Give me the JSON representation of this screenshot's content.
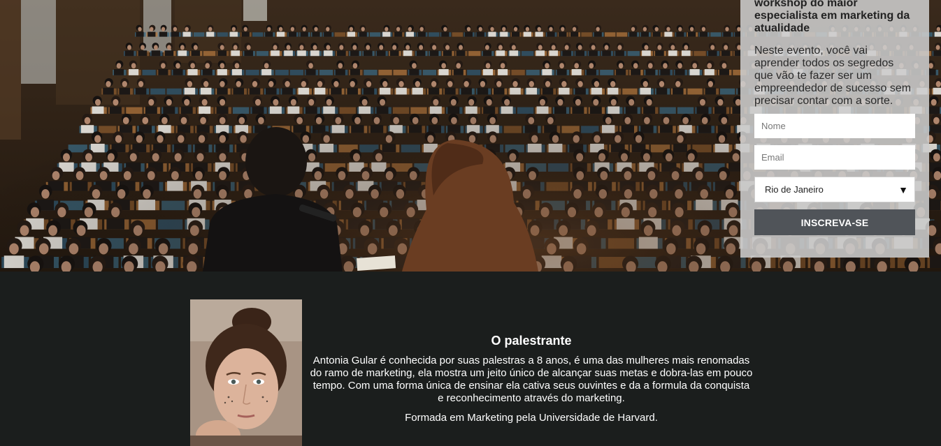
{
  "hero": {
    "image": "auditorium-speaker-photo"
  },
  "form": {
    "title": "workshop do maior especialista em marketing da atualidade",
    "description": "Neste evento, você vai aprender todos os segredos que vão te fazer ser um empreendedor de sucesso sem precisar contar com a sorte.",
    "name_placeholder": "Nome",
    "email_placeholder": "Email",
    "city_selected": "Rio de Janeiro",
    "submit_label": "INSCREVA-SE"
  },
  "speaker": {
    "title": "O palestrante",
    "bio": "Antonia Gular é conhecida por suas palestras a 8 anos, é uma das mulheres mais renomadas do ramo de marketing, ela mostra um jeito único de alcançar suas metas e dobra-las em pouco tempo. Com uma forma única de ensinar ela cativa seus ouvintes e da a formula da conquista e reconhecimento através do marketing.",
    "education": "Formada em Marketing pela Universidade de Harvard."
  },
  "colors": {
    "page_bg": "#1b1e1d",
    "form_bg": "#cdcdcd",
    "button_bg": "#505459",
    "text_light": "#ffffff"
  }
}
